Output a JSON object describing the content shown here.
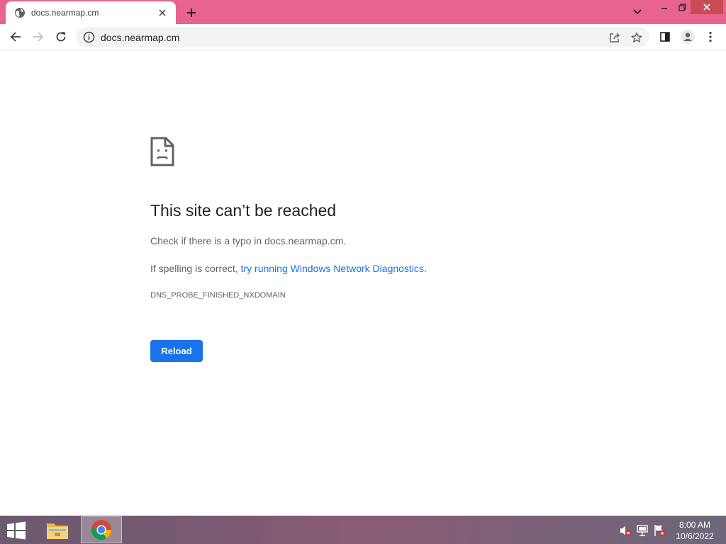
{
  "browser": {
    "tab": {
      "title": "docs.nearmap.cm"
    },
    "address_bar": {
      "url": "docs.nearmap.cm"
    },
    "theme_color": "#e8638f"
  },
  "error_page": {
    "title": "This site can’t be reached",
    "line1": "Check if there is a typo in docs.nearmap.cm.",
    "line2_prefix": "If spelling is correct, ",
    "line2_link": "try running Windows Network Diagnostics",
    "line2_suffix": ".",
    "error_code": "DNS_PROBE_FINISHED_NXDOMAIN",
    "reload_label": "Reload",
    "accent_color": "#1a73e8"
  },
  "taskbar": {
    "pinned": [
      "file-explorer-icon",
      "chrome-icon"
    ],
    "tray": [
      "speaker-muted-icon",
      "network-icon",
      "action-center-flag-icon"
    ],
    "clock": {
      "time": "8:00 AM",
      "date": "10/6/2022"
    }
  }
}
